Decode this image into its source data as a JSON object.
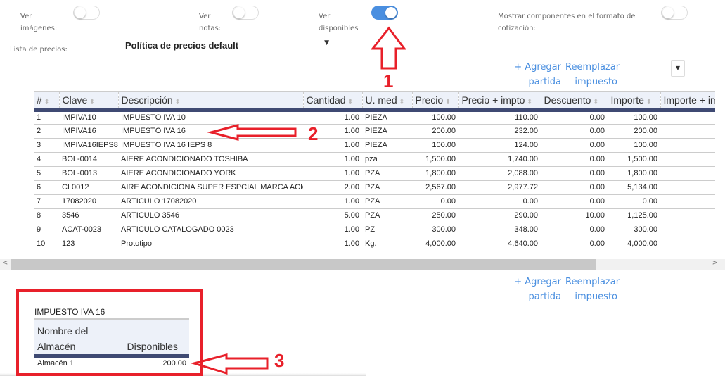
{
  "toggles": [
    {
      "label": "Ver imágenes:",
      "on": false
    },
    {
      "label": "Ver notas:",
      "on": false
    },
    {
      "label": "Ver disponibles",
      "on": true
    },
    {
      "label": "Mostrar componentes en el formato de cotización:",
      "on": false
    }
  ],
  "price_list": {
    "label": "Lista de precios:",
    "value": "Política de precios default"
  },
  "actions": {
    "add": "+ Agregar partida",
    "replace": "Reemplazar impuesto"
  },
  "table": {
    "columns": [
      "#",
      "Clave",
      "Descripción",
      "Cantidad",
      "U. med",
      "Precio",
      "Precio + impto",
      "Descuento",
      "Importe",
      "Importe + impto"
    ],
    "rows": [
      [
        "1",
        "IMPIVA10",
        "IMPUESTO IVA 10",
        "1.00",
        "PIEZA",
        "100.00",
        "110.00",
        "0.00",
        "100.00"
      ],
      [
        "2",
        "IMPIVA16",
        "IMPUESTO IVA 16",
        "1.00",
        "PIEZA",
        "200.00",
        "232.00",
        "0.00",
        "200.00"
      ],
      [
        "3",
        "IMPIVA16IEPS8",
        "IMPUESTO IVA 16 IEPS 8",
        "1.00",
        "PIEZA",
        "100.00",
        "124.00",
        "0.00",
        "100.00"
      ],
      [
        "4",
        "BOL-0014",
        "AIERE ACONDICIONADO TOSHIBA",
        "1.00",
        "pza",
        "1,500.00",
        "1,740.00",
        "0.00",
        "1,500.00"
      ],
      [
        "5",
        "BOL-0013",
        "AIERE ACONDICIONADO YORK",
        "1.00",
        "PZA",
        "1,800.00",
        "2,088.00",
        "0.00",
        "1,800.00"
      ],
      [
        "6",
        "CL0012",
        "AIRE ACONDICIONA SUPER ESPCIAL MARCA ACME",
        "2.00",
        "PZA",
        "2,567.00",
        "2,977.72",
        "0.00",
        "5,134.00"
      ],
      [
        "7",
        "17082020",
        "ARTICULO 17082020",
        "1.00",
        "PZA",
        "0.00",
        "0.00",
        "0.00",
        "0.00"
      ],
      [
        "8",
        "3546",
        "ARTICULO 3546",
        "5.00",
        "PZA",
        "250.00",
        "290.00",
        "10.00",
        "1,125.00"
      ],
      [
        "9",
        "ACAT-0023",
        "ARTICULO CATALOGADO 0023",
        "1.00",
        "PZ",
        "300.00",
        "348.00",
        "0.00",
        "300.00"
      ],
      [
        "10",
        "123",
        "Prototipo",
        "1.00",
        "Kg.",
        "4,000.00",
        "4,640.00",
        "0.00",
        "4,000.00"
      ]
    ]
  },
  "stock": {
    "title": "IMPUESTO IVA 16",
    "columns": [
      "Nombre del Almacén",
      "Disponibles"
    ],
    "rows": [
      [
        "Almacén 1",
        "200.00"
      ]
    ]
  },
  "annotations": [
    "1",
    "2",
    "3"
  ],
  "colors": {
    "accent": "#4a8fe0",
    "header_bar": "#3f4a73",
    "annotation": "#e8202a"
  }
}
